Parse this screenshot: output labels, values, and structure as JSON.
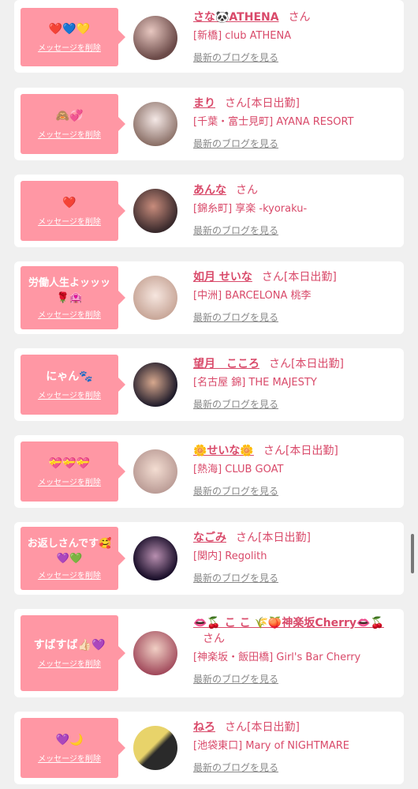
{
  "entries": [
    {
      "message": "❤️💙💛",
      "delete": "メッセージを削除",
      "name": "さな🐼ATHENA",
      "san": "さん",
      "badge": "",
      "shop": "[新橋] club ATHENA",
      "blog": "最新のブログを見る"
    },
    {
      "message": "🙈💞",
      "delete": "メッセージを削除",
      "name": "まり",
      "san": "さん",
      "badge": "[本日出勤]",
      "shop": "[千葉・富士見町] AYANA RESORT",
      "blog": "最新のブログを見る"
    },
    {
      "message": "❤️",
      "delete": "メッセージを削除",
      "name": "あんな",
      "san": "さん",
      "badge": "",
      "shop": "[錦糸町] 享楽 -kyoraku-",
      "blog": "最新のブログを見る"
    },
    {
      "message": "労働人生よッッッ\n🌹🏩",
      "delete": "メッセージを削除",
      "name": "如月 せいな",
      "san": "さん",
      "badge": "[本日出勤]",
      "shop": "[中洲] BARCELONA 桃李",
      "blog": "最新のブログを見る"
    },
    {
      "message": "にゃん🐾",
      "delete": "メッセージを削除",
      "name": "望月　こころ",
      "san": "さん",
      "badge": "[本日出勤]",
      "shop": "[名古屋 錦] THE MAJESTY",
      "blog": "最新のブログを見る"
    },
    {
      "message": "💝💝💝",
      "delete": "メッセージを削除",
      "name": "🌼せいな🌼",
      "san": "さん",
      "badge": "[本日出勤]",
      "shop": "[熱海] CLUB GOAT",
      "blog": "最新のブログを見る"
    },
    {
      "message": "お返しさんです🥰\n💜💚",
      "delete": "メッセージを削除",
      "name": "なごみ",
      "san": "さん",
      "badge": "[本日出勤]",
      "shop": "[関内] Regolith",
      "blog": "最新のブログを見る"
    },
    {
      "message": "すばすば👍🏻💜",
      "delete": "メッセージを削除",
      "name": "👄🍒 こ こ 🌾🍑神楽坂Cherry👄🍒",
      "san": "さん",
      "badge": "",
      "shop": "[神楽坂・飯田橋] Girl's Bar Cherry",
      "blog": "最新のブログを見る"
    },
    {
      "message": "💜🌙",
      "delete": "メッセージを削除",
      "name": "ねろ",
      "san": "さん",
      "badge": "[本日出勤]",
      "shop": "[池袋東口] Mary of NIGHTMARE",
      "blog": "最新のブログを見る"
    }
  ],
  "colors": {
    "accent": "#d94a6a",
    "bubble": "#ff97a4",
    "background": "#f0f0f0"
  }
}
